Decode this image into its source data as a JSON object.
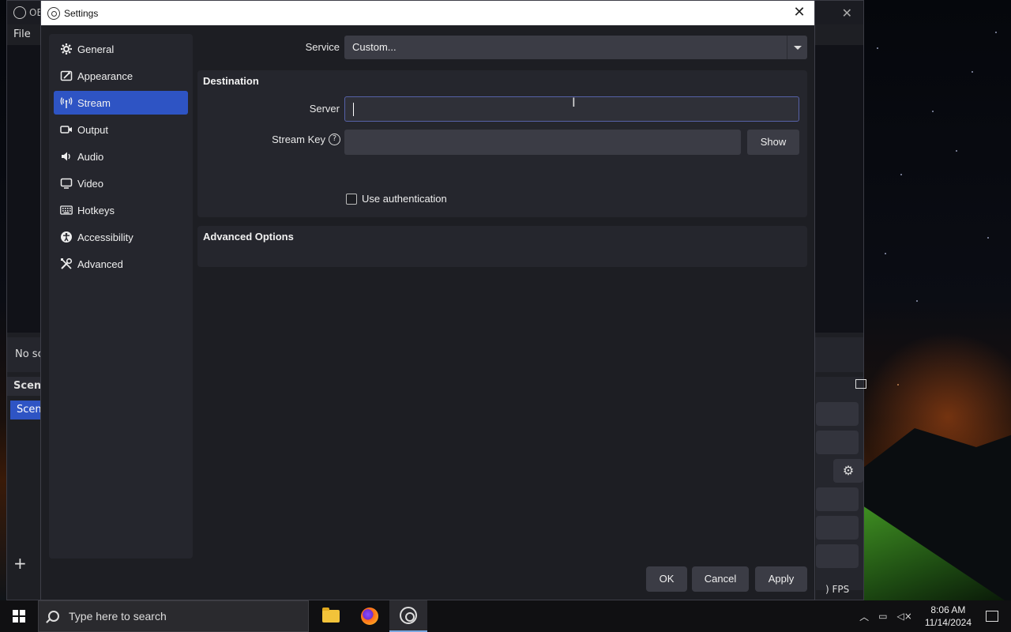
{
  "obs_main": {
    "title": "OB",
    "menu_file": "File",
    "no_source_text": "No sc",
    "scenes_header": "Scene",
    "scene_item": "Scene",
    "fps_text": ") FPS"
  },
  "dialog": {
    "title": "Settings",
    "close_glyph": "✕"
  },
  "sidebar": {
    "items": [
      {
        "label": "General",
        "icon": "gear-icon"
      },
      {
        "label": "Appearance",
        "icon": "appearance-icon"
      },
      {
        "label": "Stream",
        "icon": "antenna-icon",
        "active": true
      },
      {
        "label": "Output",
        "icon": "camera-icon"
      },
      {
        "label": "Audio",
        "icon": "speaker-icon"
      },
      {
        "label": "Video",
        "icon": "monitor-icon"
      },
      {
        "label": "Hotkeys",
        "icon": "keyboard-icon"
      },
      {
        "label": "Accessibility",
        "icon": "accessibility-icon"
      },
      {
        "label": "Advanced",
        "icon": "tools-icon"
      }
    ]
  },
  "stream": {
    "service_label": "Service",
    "service_value": "Custom...",
    "destination_title": "Destination",
    "server_label": "Server",
    "server_value": "",
    "stream_key_label": "Stream Key",
    "stream_key_value": "",
    "show_button": "Show",
    "use_auth_label": "Use authentication",
    "use_auth_checked": false,
    "advanced_title": "Advanced Options"
  },
  "footer": {
    "ok": "OK",
    "cancel": "Cancel",
    "apply": "Apply"
  },
  "taskbar": {
    "search_placeholder": "Type here to search",
    "time": "8:06 AM",
    "date": "11/14/2024"
  },
  "colors": {
    "accent": "#2e54c4",
    "dialog_bg": "#1d1e23",
    "panel_bg": "#25262d",
    "input_bg": "#3b3c45",
    "focus_border": "#5661a8"
  }
}
